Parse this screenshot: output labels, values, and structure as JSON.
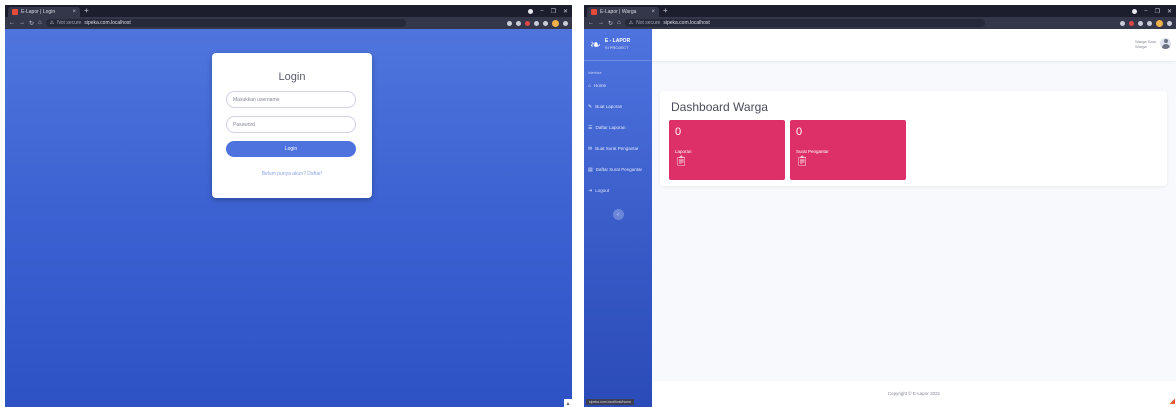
{
  "login_window": {
    "tab_title": "E-Lapor | Login",
    "tab_close": "×",
    "new_tab": "+",
    "address_warning": "Not secure",
    "url": "sipeka.com.localhost",
    "title": "Login",
    "username_placeholder": "Masukkan username",
    "password_placeholder": "Password",
    "login_button": "Login",
    "link_text": "Belum punya akun? Daftar!"
  },
  "dashboard_window": {
    "tab_title": "E-Lapor | Warga",
    "tab_close": "×",
    "new_tab": "+",
    "address_warning": "Not secure",
    "url": "sipeka.com.localhost",
    "brand_title": "E - LAPOR",
    "brand_subtitle": "SI PROJECT",
    "sidebar_heading": "Interface",
    "sidebar_items": [
      {
        "icon": "home-icon",
        "glyph": "⌂",
        "label": "Home"
      },
      {
        "icon": "edit-icon",
        "glyph": "✎",
        "label": "Buat Laporan"
      },
      {
        "icon": "list-icon",
        "glyph": "☰",
        "label": "Daftar Laporan"
      },
      {
        "icon": "mail-icon",
        "glyph": "✉",
        "label": "Buat Surat Pengantar"
      },
      {
        "icon": "file-icon",
        "glyph": "▤",
        "label": "Daftar Surat Pengantar"
      },
      {
        "icon": "logout-icon",
        "glyph": "⇥",
        "label": "Logout"
      }
    ],
    "sidebar_toggle": "‹",
    "user_name": "Warga Satu",
    "user_role": "Warga",
    "heading": "Dashboard Warga",
    "stats": [
      {
        "value": "0",
        "label": "Laporan",
        "icon": "clipboard-icon"
      },
      {
        "value": "0",
        "label": "Surat Pengantar",
        "icon": "clipboard-icon"
      }
    ],
    "footer": "Copyright © E-Lapor 2021",
    "status_bar": "sipeka.com.localhost/home"
  },
  "colors": {
    "sidebar": "#4e73df",
    "stat_card": "#dd2f68",
    "login_bg": "#3d63d3"
  }
}
